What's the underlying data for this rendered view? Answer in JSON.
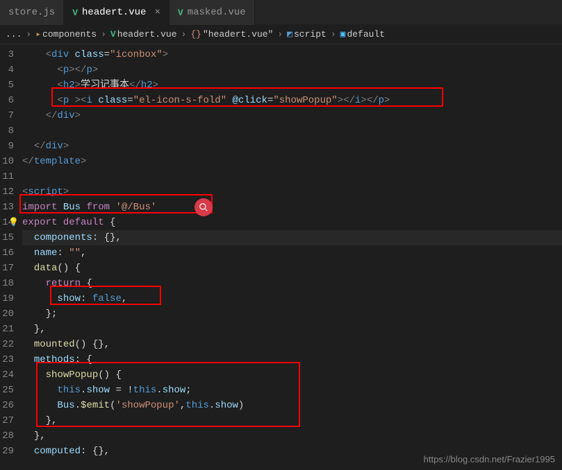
{
  "tabs": [
    {
      "label": "store.js",
      "icon": ""
    },
    {
      "label": "headert.vue",
      "icon": "V",
      "active": true
    },
    {
      "label": "masked.vue",
      "icon": "V"
    }
  ],
  "breadcrumb": {
    "items": [
      "...",
      "components",
      "headert.vue",
      "\"headert.vue\"",
      "script",
      "default"
    ],
    "sep": "›"
  },
  "lines": {
    "3": {
      "num": "3"
    },
    "4": {
      "num": "4",
      "tag_open": "<",
      "tag_p": "p",
      "tag_close": ">",
      "tag_end_open": "</",
      "tag_end_close": ">"
    },
    "5": {
      "num": "5",
      "tag_h2": "h2",
      "text": "学习记事本"
    },
    "6": {
      "num": "6",
      "tag_p": "p",
      "tag_i": "i",
      "attr_class": "class",
      "val_class": "el-icon-s-fold",
      "attr_click": "@click",
      "val_click": "showPopup"
    },
    "7": {
      "num": "7",
      "tag_div": "div"
    },
    "8": {
      "num": "8"
    },
    "9": {
      "num": "9",
      "tag_div": "div"
    },
    "10": {
      "num": "10",
      "tag_template": "template"
    },
    "11": {
      "num": "11"
    },
    "12": {
      "num": "12",
      "tag_script": "script"
    },
    "13": {
      "num": "13",
      "kw_import": "import",
      "id_bus": "Bus",
      "kw_from": "from",
      "str_bus": "'@/Bus'"
    },
    "14": {
      "num": "14",
      "kw_export": "export",
      "kw_default": "default"
    },
    "15": {
      "num": "15",
      "id_components": "components"
    },
    "16": {
      "num": "16",
      "id_name": "name",
      "str_empty": "\"\""
    },
    "17": {
      "num": "17",
      "func_data": "data"
    },
    "18": {
      "num": "18",
      "kw_return": "return"
    },
    "19": {
      "num": "19",
      "id_show": "show",
      "lit_false": "false"
    },
    "20": {
      "num": "20"
    },
    "21": {
      "num": "21"
    },
    "22": {
      "num": "22",
      "func_mounted": "mounted"
    },
    "23": {
      "num": "23",
      "id_methods": "methods"
    },
    "24": {
      "num": "24",
      "func_showPopup": "showPopup"
    },
    "25": {
      "num": "25",
      "kw_this1": "this",
      "prop_show1": "show",
      "kw_this2": "this",
      "prop_show2": "show"
    },
    "26": {
      "num": "26",
      "id_bus": "Bus",
      "func_emit": "$emit",
      "str_event": "'showPopup'",
      "kw_this": "this",
      "prop_show": "show"
    },
    "27": {
      "num": "27"
    },
    "28": {
      "num": "28"
    },
    "29": {
      "num": "29",
      "id_computed": "computed"
    }
  },
  "watermark": "https://blog.csdn.net/Frazier1995"
}
